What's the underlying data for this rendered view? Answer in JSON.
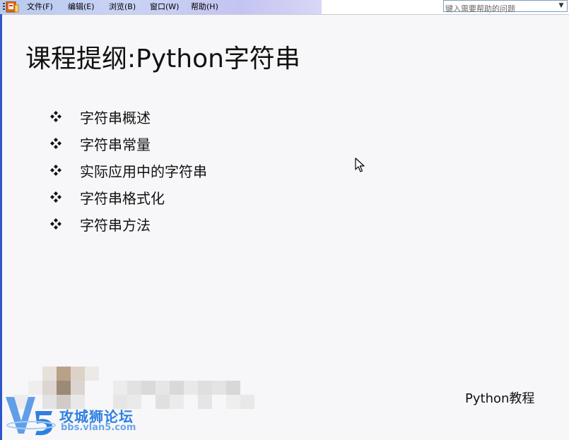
{
  "menubar": {
    "items": [
      {
        "label": "文件(F)"
      },
      {
        "label": "编辑(E)"
      },
      {
        "label": "浏览(B)"
      },
      {
        "label": "窗口(W)"
      },
      {
        "label": "帮助(H)"
      }
    ],
    "help_placeholder": "键入需要帮助的问题"
  },
  "slide": {
    "title": "课程提纲:Python字符串",
    "bullets": [
      "字符串概述",
      "字符串常量",
      "实际应用中的字符串",
      "字符串格式化",
      "字符串方法"
    ],
    "footer": "Python教程"
  },
  "watermark": {
    "title": "攻城狮论坛",
    "subtitle": "bbs.vlan5.com"
  },
  "colors": {
    "menubar_accent": "#c4c4f2",
    "window_edge": "#2f55c8",
    "watermark_blue": "#2f7fe0"
  },
  "icons": {
    "app": "powerpoint-app-icon",
    "bullet": "diamond-four-petal-icon",
    "cursor": "mouse-pointer-icon",
    "dropdown": "chevron-down-icon"
  }
}
